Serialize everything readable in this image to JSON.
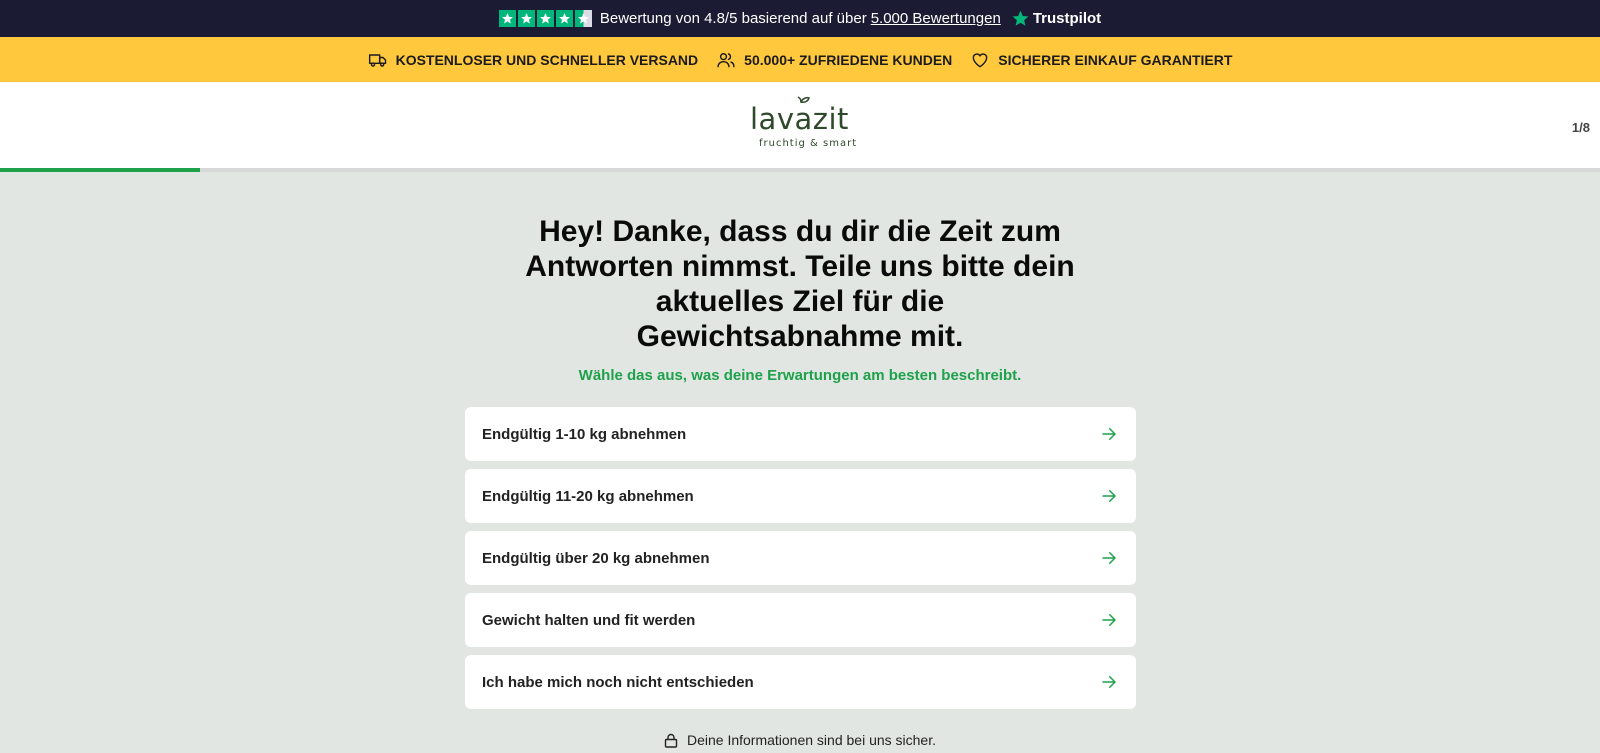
{
  "topbar": {
    "rating_text": "Bewertung von 4.8/5 basierend auf über",
    "reviews_link": "5.000 Bewertungen",
    "brand": "Trustpilot",
    "stars": 4.5,
    "star_color": "#00b67a"
  },
  "benefits": [
    {
      "icon": "truck-icon",
      "label": "KOSTENLOSER UND SCHNELLER VERSAND"
    },
    {
      "icon": "users-icon",
      "label": "50.000+ ZUFRIEDENE KUNDEN"
    },
    {
      "icon": "heart-icon",
      "label": "SICHERER EINKAUF GARANTIERT"
    }
  ],
  "header": {
    "logo_text": "lavazit",
    "logo_tagline": "fruchtig & smart",
    "step_counter": "1/8",
    "progress": 0.125
  },
  "question": {
    "title": "Hey! Danke, dass du dir die Zeit zum Antworten nimmst. Teile uns bitte dein aktuelles Ziel für die Gewichtsabnahme mit.",
    "subtitle": "Wähle das aus, was deine Erwartungen am besten beschreibt."
  },
  "options": [
    {
      "label": "Endgültig 1-10 kg abnehmen"
    },
    {
      "label": "Endgültig 11-20 kg abnehmen"
    },
    {
      "label": "Endgültig über 20 kg abnehmen"
    },
    {
      "label": "Gewicht halten und fit werden"
    },
    {
      "label": "Ich habe mich noch nicht entschieden"
    }
  ],
  "footer": {
    "secure_text": "Deine Informationen sind bei uns sicher."
  },
  "colors": {
    "topbar_bg": "#1b1b33",
    "benefit_bar_bg": "#ffc83d",
    "accent_green": "#1ea14b",
    "page_bg": "#e2e6e3"
  }
}
